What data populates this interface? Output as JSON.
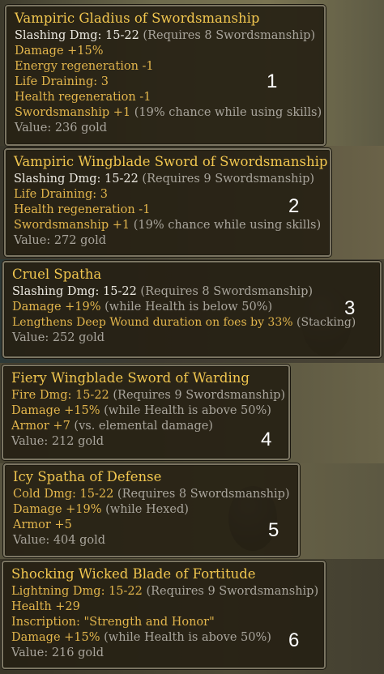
{
  "tooltips": [
    {
      "number": "1",
      "title": "Vampiric Gladius of Swordsmanship",
      "lines": [
        {
          "a": "Slashing Dmg: 15-22",
          "b": " (Requires 8 Swordsmanship)",
          "color": "white"
        },
        {
          "a": "Damage +15%",
          "b": "",
          "color": "gold"
        },
        {
          "a": "Energy regeneration -1",
          "b": "",
          "color": "gold"
        },
        {
          "a": "Life Draining: 3",
          "b": "",
          "color": "gold"
        },
        {
          "a": "Health regeneration -1",
          "b": "",
          "color": "gold"
        },
        {
          "a": "Swordsmanship +1",
          "b": " (19% chance while using skills)",
          "color": "gold"
        },
        {
          "a": "Value: 236 gold",
          "b": "",
          "color": "gray"
        }
      ]
    },
    {
      "number": "2",
      "title": "Vampiric Wingblade Sword of Swordsmanship",
      "lines": [
        {
          "a": "Slashing Dmg: 15-22",
          "b": " (Requires 9 Swordsmanship)",
          "color": "white"
        },
        {
          "a": "Life Draining: 3",
          "b": "",
          "color": "gold"
        },
        {
          "a": "Health regeneration -1",
          "b": "",
          "color": "gold"
        },
        {
          "a": "Swordsmanship +1",
          "b": " (19% chance while using skills)",
          "color": "gold"
        },
        {
          "a": "Value: 272 gold",
          "b": "",
          "color": "gray"
        }
      ]
    },
    {
      "number": "3",
      "title": "Cruel Spatha",
      "lines": [
        {
          "a": "Slashing Dmg: 15-22",
          "b": " (Requires 8 Swordsmanship)",
          "color": "white"
        },
        {
          "a": "Damage +19%",
          "b": " (while Health is below 50%)",
          "color": "gold"
        },
        {
          "a": "Lengthens Deep Wound duration on foes by 33%",
          "b": " (Stacking)",
          "color": "gold"
        },
        {
          "a": "Value: 252 gold",
          "b": "",
          "color": "gray"
        }
      ]
    },
    {
      "number": "4",
      "title": "Fiery Wingblade Sword of Warding",
      "lines": [
        {
          "a": "Fire Dmg: 15-22",
          "b": " (Requires 9 Swordsmanship)",
          "color": "gold"
        },
        {
          "a": "Damage +15%",
          "b": " (while Health is above 50%)",
          "color": "gold"
        },
        {
          "a": "Armor +7",
          "b": " (vs. elemental damage)",
          "color": "gold"
        },
        {
          "a": "Value: 212 gold",
          "b": "",
          "color": "gray"
        }
      ]
    },
    {
      "number": "5",
      "title": "Icy Spatha of Defense",
      "lines": [
        {
          "a": "Cold Dmg: 15-22",
          "b": " (Requires 8 Swordsmanship)",
          "color": "gold"
        },
        {
          "a": "Damage +19%",
          "b": " (while Hexed)",
          "color": "gold"
        },
        {
          "a": "Armor +5",
          "b": "",
          "color": "gold"
        },
        {
          "a": "Value: 404 gold",
          "b": "",
          "color": "gray"
        }
      ]
    },
    {
      "number": "6",
      "title": "Shocking Wicked Blade of Fortitude",
      "lines": [
        {
          "a": "Lightning Dmg: 15-22",
          "b": " (Requires 9 Swordsmanship)",
          "color": "gold"
        },
        {
          "a": "Health +29",
          "b": "",
          "color": "gold"
        },
        {
          "a": "Inscription: \"Strength and Honor\"",
          "b": "",
          "color": "gold"
        },
        {
          "a": "Damage +15%",
          "b": " (while Health is above 50%)",
          "color": "gold"
        },
        {
          "a": "Value: 216 gold",
          "b": "",
          "color": "gray"
        }
      ]
    }
  ]
}
